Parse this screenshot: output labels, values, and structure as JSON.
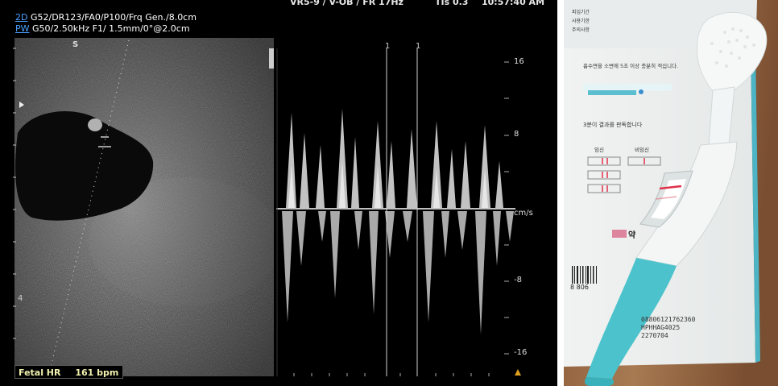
{
  "ultrasound": {
    "header_top_left": "VR5-9 / V-OB / FR 17Hz",
    "header_top_mid": "TIs 0.3",
    "header_time": "10:57:40 AM",
    "line1_mode": "2D",
    "line1_params": "G52/DR123/FA0/P100/Frq Gen./8.0cm",
    "line2_mode": "PW",
    "line2_params": "G50/2.50kHz F1/ 1.5mm/0°@2.0cm",
    "scale_labels": [
      "16",
      "8",
      "cm/s",
      "-8",
      "-16"
    ],
    "cursor_labels": [
      "1",
      "1"
    ],
    "fetal_hr_label": "Fetal HR",
    "fetal_hr_value": "161",
    "fetal_hr_unit": "bpm",
    "probe_marker": "S",
    "depth_marker": "4"
  },
  "test_photo": {
    "box_labels": [
      "피임기간",
      "사용기한",
      "주의사항"
    ],
    "instruction_text": "흡수면을 소변에 5초 이상 충분히 적십니다.",
    "step_text": "3분이 결과를 판독합니다",
    "result_positive": "임신",
    "result_negative": "비임신",
    "lot_number": "08806121762360",
    "code": "HPHHAG4025",
    "date_code": "2270704",
    "barcode_digit": "8 806",
    "brand_fragment": "약",
    "colors": {
      "test_body": "#f4f6f6",
      "test_cap": "#4cc3cc",
      "result_line": "#e0304a"
    }
  }
}
